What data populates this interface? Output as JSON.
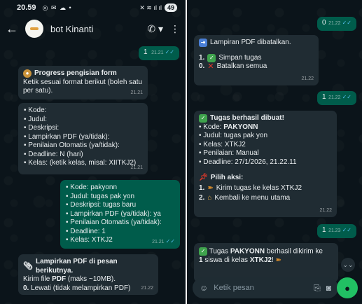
{
  "status": {
    "time": "20.59",
    "battery": "49"
  },
  "header": {
    "title": "bot Kinanti"
  },
  "left_messages": {
    "m1": {
      "text": "1",
      "time": "21.21"
    },
    "m2": {
      "title": "Progress pengisian form",
      "body": "Ketik sesuai format berikut (boleh satu per satu).",
      "time": "21.21"
    },
    "m3": {
      "items": [
        "Kode:",
        "Judul:",
        "Deskripsi:",
        "Lampirkan PDF (ya/tidak):",
        "Penilaian Otomatis (ya/tidak):",
        "Deadline: N (hari)",
        "Kelas: (ketik kelas, misal: XIITKJ2)"
      ],
      "time": "21.21"
    },
    "m4": {
      "items": [
        "Kode: pakyonn",
        "Judul: tugas pak yon",
        "Deskripsi: tugas baru",
        "Lampirkan PDF (ya/tidak): ya",
        "Penilaian Otomatis (ya/tidak):",
        "Deadline: 1",
        "Kelas: XTKJ2"
      ],
      "time": "21.21"
    },
    "m5": {
      "title": "Lampirkan PDF di pesan berikutnya.",
      "line1_pre": "Kirim file ",
      "line1_bold": "PDF",
      "line1_post": " (maks ~10MB).",
      "line2_num": "0.",
      "line2_text": " Lewati (tidak melampirkan PDF)",
      "time": "21.22"
    }
  },
  "right_messages": {
    "r1": {
      "text": "0",
      "time": "21.22"
    },
    "r2": {
      "title": "Lampiran PDF dibatalkan.",
      "opt1_num": "1.",
      "opt1_text": "Simpan tugas",
      "opt2_num": "0.",
      "opt2_text": "Batalkan semua",
      "time": "21.22"
    },
    "r3": {
      "text": "1",
      "time": "21.22"
    },
    "r4": {
      "title": "Tugas berhasil dibuat!",
      "kode_label": "Kode: ",
      "kode_value": "PAKYONN",
      "lines": [
        "Judul: tugas pak yon",
        "Kelas: XTKJ2",
        "Penilaian: Manual",
        "Deadline: 27/1/2026, 21.22.11"
      ],
      "aksi_title": "Pilih aksi:",
      "aksi1_num": "1.",
      "aksi1_text": "Kirim tugas ke kelas XTKJ2",
      "aksi2_num": "2.",
      "aksi2_text": "Kembali ke menu utama",
      "time": "21.22"
    },
    "r5": {
      "text": "1",
      "time": "21.23"
    },
    "r6": {
      "pre": "Tugas ",
      "bold1": "PAKYONN",
      "mid": " berhasil dikirim ke",
      "num": "1",
      "mid2": " siswa di kelas ",
      "bold2": "XTKJ2",
      "post": "!"
    }
  },
  "composer": {
    "placeholder": "Ketik pesan"
  },
  "colors": {
    "incoming": "#202c33",
    "outgoing": "#005c4b",
    "background": "#0b141a",
    "accent": "#21c063"
  }
}
